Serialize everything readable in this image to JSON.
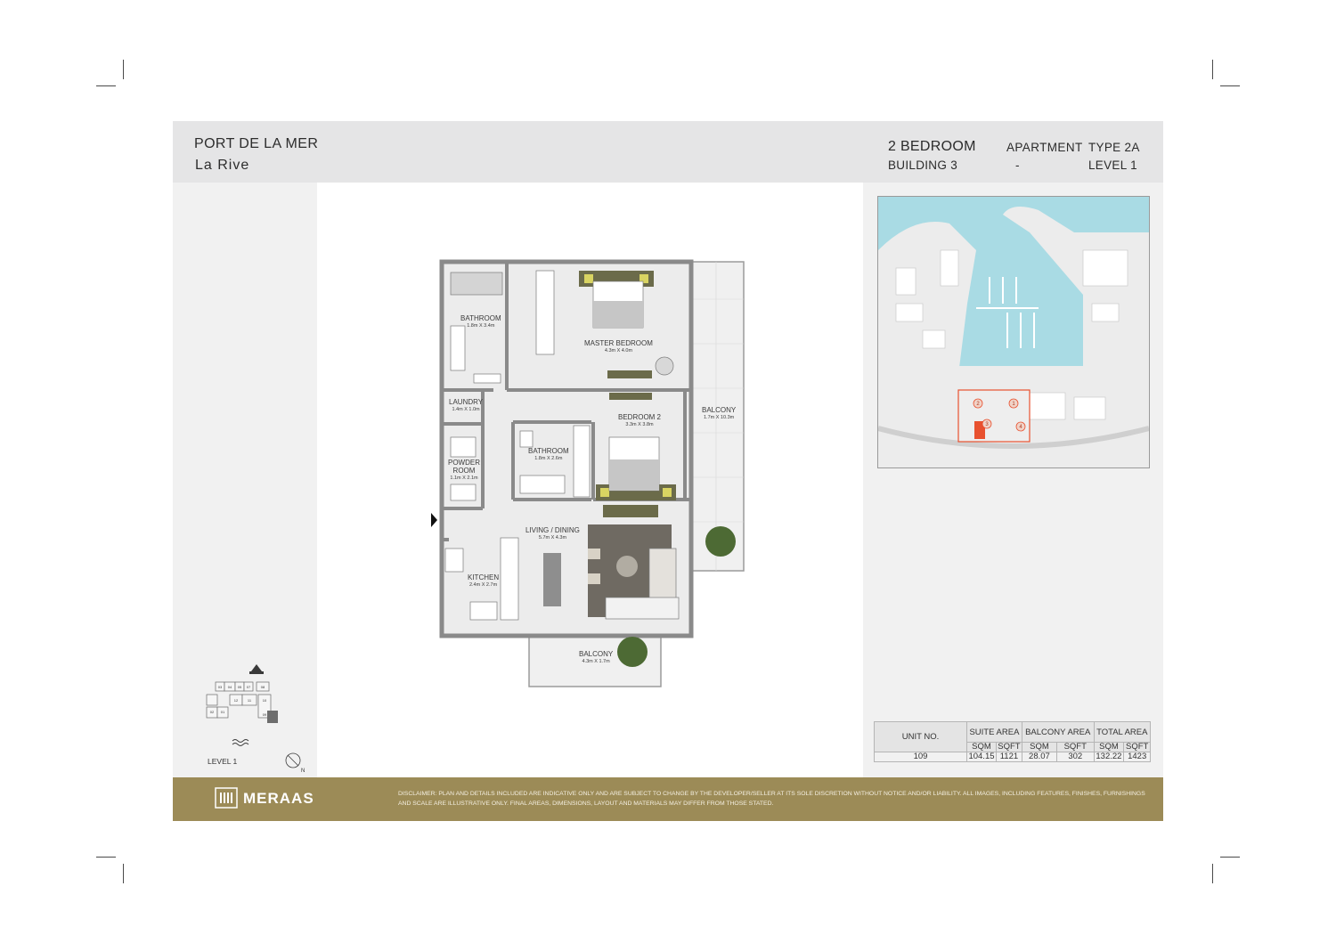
{
  "header": {
    "project": "PORT DE LA MER",
    "building_name": "La  Rive",
    "bedrooms": "2 BEDROOM",
    "building": "BUILDING 3",
    "apartment_label": "APARTMENT",
    "separator": "-",
    "type": "TYPE 2A",
    "level": "LEVEL 1"
  },
  "rooms": [
    {
      "name": "BATHROOM",
      "dim": "1.8m X 3.4m"
    },
    {
      "name": "MASTER BEDROOM",
      "dim": "4.3m X 4.0m"
    },
    {
      "name": "LAUNDRY",
      "dim": "1.4m X 1.0m"
    },
    {
      "name": "BEDROOM 2",
      "dim": "3.3m X 3.8m"
    },
    {
      "name": "BALCONY",
      "dim": "1.7m X 10.3m"
    },
    {
      "name": "BATHROOM",
      "dim": "1.8m X 2.6m"
    },
    {
      "name": "POWDER ROOM",
      "dim": "1.1m X 2.1m"
    },
    {
      "name": "LIVING / DINING",
      "dim": "5.7m X 4.3m"
    },
    {
      "name": "KITCHEN",
      "dim": "2.4m X 2.7m"
    },
    {
      "name": "BALCONY",
      "dim": "4.3m X 1.7m"
    }
  ],
  "keyplan": {
    "level_label": "LEVEL 1",
    "north": "N",
    "units": [
      "03",
      "04",
      "05",
      "07",
      "08",
      "02",
      "01",
      "12",
      "11",
      "10",
      "09"
    ]
  },
  "sitemap": {
    "markers": [
      "1",
      "2",
      "3",
      "4"
    ],
    "colors": {
      "water": "#a9dbe4",
      "land": "#ececec",
      "highlight": "#e8512f"
    }
  },
  "area_table": {
    "unit_header": "UNIT NO.",
    "groups": [
      "SUITE AREA",
      "BALCONY AREA",
      "TOTAL AREA"
    ],
    "subheaders": [
      "SQM",
      "SQFT",
      "SQM",
      "SQFT",
      "SQM",
      "SQFT"
    ],
    "row": {
      "unit": "109",
      "values": [
        "104.15",
        "1121",
        "28.07",
        "302",
        "132.22",
        "1423"
      ]
    }
  },
  "footer": {
    "brand": "MERAAS",
    "disclaimer": "DISCLAIMER: PLAN AND DETAILS INCLUDED ARE INDICATIVE ONLY AND ARE SUBJECT TO CHANGE BY THE DEVELOPER/SELLER AT ITS SOLE DISCRETION WITHOUT NOTICE AND/OR LIABILITY. ALL IMAGES, INCLUDING FEATURES, FINISHES, FURNISHINGS AND SCALE ARE ILLUSTRATIVE ONLY. FINAL AREAS, DIMENSIONS, LAYOUT AND MATERIALS MAY DIFFER FROM THOSE STATED.",
    "color": "#9c8b57"
  }
}
